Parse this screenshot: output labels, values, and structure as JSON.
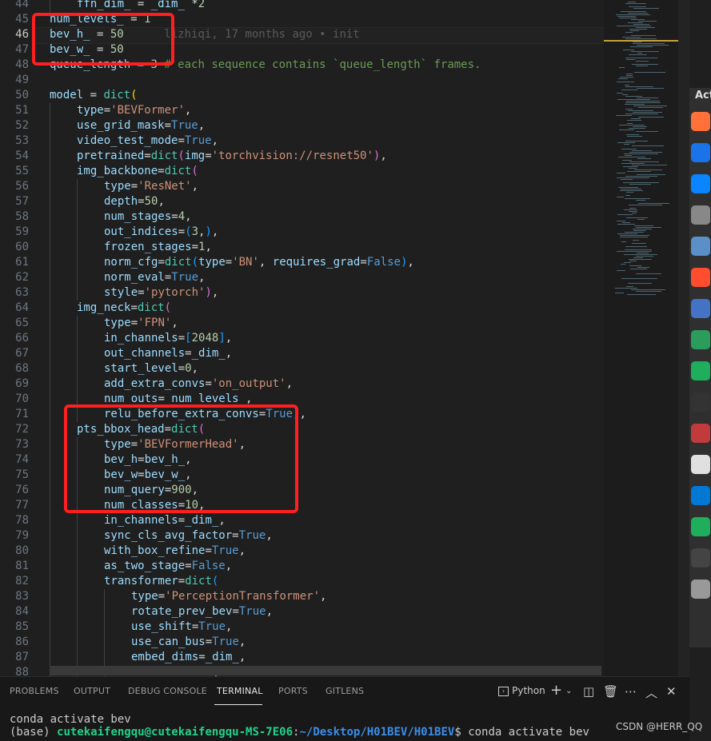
{
  "editor": {
    "active_line": 46,
    "blame_text": "lizhiqi, 17 months ago • init",
    "lines": [
      {
        "n": 44,
        "indent": 1,
        "parts": [
          [
            "k",
            "ffn_dim_"
          ],
          [
            "o",
            " = "
          ],
          [
            "k",
            "_dim_"
          ],
          [
            "o",
            " *"
          ],
          [
            "n",
            "2"
          ]
        ]
      },
      {
        "n": 45,
        "indent": 0,
        "parts": [
          [
            "k",
            "num_levels_"
          ],
          [
            "o",
            " = "
          ],
          [
            "n",
            "1"
          ]
        ]
      },
      {
        "n": 46,
        "indent": 0,
        "parts": [
          [
            "k",
            "bev_h_"
          ],
          [
            "o",
            " = "
          ],
          [
            "n",
            "50"
          ]
        ]
      },
      {
        "n": 47,
        "indent": 0,
        "parts": [
          [
            "k",
            "bev_w_"
          ],
          [
            "o",
            " = "
          ],
          [
            "n",
            "50"
          ]
        ]
      },
      {
        "n": 48,
        "indent": 0,
        "parts": [
          [
            "k",
            "queue_length"
          ],
          [
            "o",
            " = "
          ],
          [
            "n",
            "3"
          ],
          [
            "c",
            " # each sequence contains `queue_length` frames."
          ]
        ]
      },
      {
        "n": 49,
        "indent": 0,
        "parts": []
      },
      {
        "n": 50,
        "indent": 0,
        "parts": [
          [
            "k",
            "model"
          ],
          [
            "o",
            " = "
          ],
          [
            "f",
            "dict"
          ],
          [
            "p",
            "("
          ]
        ]
      },
      {
        "n": 51,
        "indent": 1,
        "parts": [
          [
            "k",
            "type"
          ],
          [
            "o",
            "="
          ],
          [
            "s",
            "'BEVFormer'"
          ],
          [
            "o",
            ","
          ]
        ]
      },
      {
        "n": 52,
        "indent": 1,
        "parts": [
          [
            "k",
            "use_grid_mask"
          ],
          [
            "o",
            "="
          ],
          [
            "kw",
            "True"
          ],
          [
            "o",
            ","
          ]
        ]
      },
      {
        "n": 53,
        "indent": 1,
        "parts": [
          [
            "k",
            "video_test_mode"
          ],
          [
            "o",
            "="
          ],
          [
            "kw",
            "True"
          ],
          [
            "o",
            ","
          ]
        ]
      },
      {
        "n": 54,
        "indent": 1,
        "parts": [
          [
            "k",
            "pretrained"
          ],
          [
            "o",
            "="
          ],
          [
            "f",
            "dict"
          ],
          [
            "p2",
            "("
          ],
          [
            "k",
            "img"
          ],
          [
            "o",
            "="
          ],
          [
            "s",
            "'torchvision://resnet50'"
          ],
          [
            "p2",
            ")"
          ],
          [
            "o",
            ","
          ]
        ]
      },
      {
        "n": 55,
        "indent": 1,
        "parts": [
          [
            "k",
            "img_backbone"
          ],
          [
            "o",
            "="
          ],
          [
            "f",
            "dict"
          ],
          [
            "p2",
            "("
          ]
        ]
      },
      {
        "n": 56,
        "indent": 2,
        "parts": [
          [
            "k",
            "type"
          ],
          [
            "o",
            "="
          ],
          [
            "s",
            "'ResNet'"
          ],
          [
            "o",
            ","
          ]
        ]
      },
      {
        "n": 57,
        "indent": 2,
        "parts": [
          [
            "k",
            "depth"
          ],
          [
            "o",
            "="
          ],
          [
            "n",
            "50"
          ],
          [
            "o",
            ","
          ]
        ]
      },
      {
        "n": 58,
        "indent": 2,
        "parts": [
          [
            "k",
            "num_stages"
          ],
          [
            "o",
            "="
          ],
          [
            "n",
            "4"
          ],
          [
            "o",
            ","
          ]
        ]
      },
      {
        "n": 59,
        "indent": 2,
        "parts": [
          [
            "k",
            "out_indices"
          ],
          [
            "o",
            "="
          ],
          [
            "p3",
            "("
          ],
          [
            "n",
            "3"
          ],
          [
            "o",
            ","
          ],
          [
            "p3",
            ")"
          ],
          [
            "o",
            ","
          ]
        ]
      },
      {
        "n": 60,
        "indent": 2,
        "parts": [
          [
            "k",
            "frozen_stages"
          ],
          [
            "o",
            "="
          ],
          [
            "n",
            "1"
          ],
          [
            "o",
            ","
          ]
        ]
      },
      {
        "n": 61,
        "indent": 2,
        "parts": [
          [
            "k",
            "norm_cfg"
          ],
          [
            "o",
            "="
          ],
          [
            "f",
            "dict"
          ],
          [
            "p3",
            "("
          ],
          [
            "k",
            "type"
          ],
          [
            "o",
            "="
          ],
          [
            "s",
            "'BN'"
          ],
          [
            "o",
            ", "
          ],
          [
            "k",
            "requires_grad"
          ],
          [
            "o",
            "="
          ],
          [
            "kw",
            "False"
          ],
          [
            "p3",
            ")"
          ],
          [
            "o",
            ","
          ]
        ]
      },
      {
        "n": 62,
        "indent": 2,
        "parts": [
          [
            "k",
            "norm_eval"
          ],
          [
            "o",
            "="
          ],
          [
            "kw",
            "True"
          ],
          [
            "o",
            ","
          ]
        ]
      },
      {
        "n": 63,
        "indent": 2,
        "parts": [
          [
            "k",
            "style"
          ],
          [
            "o",
            "="
          ],
          [
            "s",
            "'pytorch'"
          ],
          [
            "p2",
            ")"
          ],
          [
            "o",
            ","
          ]
        ]
      },
      {
        "n": 64,
        "indent": 1,
        "parts": [
          [
            "k",
            "img_neck"
          ],
          [
            "o",
            "="
          ],
          [
            "f",
            "dict"
          ],
          [
            "p2",
            "("
          ]
        ]
      },
      {
        "n": 65,
        "indent": 2,
        "parts": [
          [
            "k",
            "type"
          ],
          [
            "o",
            "="
          ],
          [
            "s",
            "'FPN'"
          ],
          [
            "o",
            ","
          ]
        ]
      },
      {
        "n": 66,
        "indent": 2,
        "parts": [
          [
            "k",
            "in_channels"
          ],
          [
            "o",
            "="
          ],
          [
            "p3",
            "["
          ],
          [
            "n",
            "2048"
          ],
          [
            "p3",
            "]"
          ],
          [
            "o",
            ","
          ]
        ]
      },
      {
        "n": 67,
        "indent": 2,
        "parts": [
          [
            "k",
            "out_channels"
          ],
          [
            "o",
            "="
          ],
          [
            "k",
            "_dim_"
          ],
          [
            "o",
            ","
          ]
        ]
      },
      {
        "n": 68,
        "indent": 2,
        "parts": [
          [
            "k",
            "start_level"
          ],
          [
            "o",
            "="
          ],
          [
            "n",
            "0"
          ],
          [
            "o",
            ","
          ]
        ]
      },
      {
        "n": 69,
        "indent": 2,
        "parts": [
          [
            "k",
            "add_extra_convs"
          ],
          [
            "o",
            "="
          ],
          [
            "s",
            "'on_output'"
          ],
          [
            "o",
            ","
          ]
        ]
      },
      {
        "n": 70,
        "indent": 2,
        "parts": [
          [
            "k",
            "num_outs"
          ],
          [
            "o",
            "="
          ],
          [
            "k",
            "_num_levels_"
          ],
          [
            "o",
            ","
          ]
        ]
      },
      {
        "n": 71,
        "indent": 2,
        "parts": [
          [
            "k",
            "relu_before_extra_convs"
          ],
          [
            "o",
            "="
          ],
          [
            "kw",
            "True"
          ],
          [
            "p2",
            ")"
          ],
          [
            "o",
            ","
          ]
        ]
      },
      {
        "n": 72,
        "indent": 1,
        "parts": [
          [
            "k",
            "pts_bbox_head"
          ],
          [
            "o",
            "="
          ],
          [
            "f",
            "dict"
          ],
          [
            "p2",
            "("
          ]
        ]
      },
      {
        "n": 73,
        "indent": 2,
        "parts": [
          [
            "k",
            "type"
          ],
          [
            "o",
            "="
          ],
          [
            "s",
            "'BEVFormerHead'"
          ],
          [
            "o",
            ","
          ]
        ]
      },
      {
        "n": 74,
        "indent": 2,
        "parts": [
          [
            "k",
            "bev_h"
          ],
          [
            "o",
            "="
          ],
          [
            "k",
            "bev_h_"
          ],
          [
            "o",
            ","
          ]
        ]
      },
      {
        "n": 75,
        "indent": 2,
        "parts": [
          [
            "k",
            "bev_w"
          ],
          [
            "o",
            "="
          ],
          [
            "k",
            "bev_w_"
          ],
          [
            "o",
            ","
          ]
        ]
      },
      {
        "n": 76,
        "indent": 2,
        "parts": [
          [
            "k",
            "num_query"
          ],
          [
            "o",
            "="
          ],
          [
            "n",
            "900"
          ],
          [
            "o",
            ","
          ]
        ]
      },
      {
        "n": 77,
        "indent": 2,
        "parts": [
          [
            "k",
            "num_classes"
          ],
          [
            "o",
            "="
          ],
          [
            "n",
            "10"
          ],
          [
            "o",
            ","
          ]
        ]
      },
      {
        "n": 78,
        "indent": 2,
        "parts": [
          [
            "k",
            "in_channels"
          ],
          [
            "o",
            "="
          ],
          [
            "k",
            "_dim_"
          ],
          [
            "o",
            ","
          ]
        ]
      },
      {
        "n": 79,
        "indent": 2,
        "parts": [
          [
            "k",
            "sync_cls_avg_factor"
          ],
          [
            "o",
            "="
          ],
          [
            "kw",
            "True"
          ],
          [
            "o",
            ","
          ]
        ]
      },
      {
        "n": 80,
        "indent": 2,
        "parts": [
          [
            "k",
            "with_box_refine"
          ],
          [
            "o",
            "="
          ],
          [
            "kw",
            "True"
          ],
          [
            "o",
            ","
          ]
        ]
      },
      {
        "n": 81,
        "indent": 2,
        "parts": [
          [
            "k",
            "as_two_stage"
          ],
          [
            "o",
            "="
          ],
          [
            "kw",
            "False"
          ],
          [
            "o",
            ","
          ]
        ]
      },
      {
        "n": 82,
        "indent": 2,
        "parts": [
          [
            "k",
            "transformer"
          ],
          [
            "o",
            "="
          ],
          [
            "f",
            "dict"
          ],
          [
            "p3",
            "("
          ]
        ]
      },
      {
        "n": 83,
        "indent": 3,
        "parts": [
          [
            "k",
            "type"
          ],
          [
            "o",
            "="
          ],
          [
            "s",
            "'PerceptionTransformer'"
          ],
          [
            "o",
            ","
          ]
        ]
      },
      {
        "n": 84,
        "indent": 3,
        "parts": [
          [
            "k",
            "rotate_prev_bev"
          ],
          [
            "o",
            "="
          ],
          [
            "kw",
            "True"
          ],
          [
            "o",
            ","
          ]
        ]
      },
      {
        "n": 85,
        "indent": 3,
        "parts": [
          [
            "k",
            "use_shift"
          ],
          [
            "o",
            "="
          ],
          [
            "kw",
            "True"
          ],
          [
            "o",
            ","
          ]
        ]
      },
      {
        "n": 86,
        "indent": 3,
        "parts": [
          [
            "k",
            "use_can_bus"
          ],
          [
            "o",
            "="
          ],
          [
            "kw",
            "True"
          ],
          [
            "o",
            ","
          ]
        ]
      },
      {
        "n": 87,
        "indent": 3,
        "parts": [
          [
            "k",
            "embed_dims"
          ],
          [
            "o",
            "="
          ],
          [
            "k",
            "_dim_"
          ],
          [
            "o",
            ","
          ]
        ]
      },
      {
        "n": 88,
        "indent": 3,
        "parts": [
          [
            "k",
            "encoder"
          ],
          [
            "o",
            "="
          ],
          [
            "f",
            "dict"
          ],
          [
            "p",
            "("
          ]
        ]
      }
    ]
  },
  "dock": {
    "label": "Act",
    "apps": [
      "firefox",
      "chrome",
      "thunderbird",
      "files",
      "app",
      "app",
      "document",
      "clion",
      "pycharm",
      "terminal",
      "app",
      "app",
      "vscode",
      "pycharm",
      "obs",
      "apps-grid"
    ]
  },
  "panel": {
    "tabs": [
      "PROBLEMS",
      "OUTPUT",
      "DEBUG CONSOLE",
      "TERMINAL",
      "PORTS",
      "GITLENS"
    ],
    "active_tab": "TERMINAL",
    "shell_label": "Python"
  },
  "terminal": {
    "line1": "conda activate bev",
    "prefix": "(base) ",
    "user_host": "cutekaifengqu@cutekaifengqu-MS-7E06",
    "colon": ":",
    "path": "~/Desktop/H01BEV/H01BEV",
    "dollar": "$ ",
    "command": "conda activate bev"
  },
  "watermark": "CSDN @HERR_QQ",
  "colors": {
    "annotation": "#ff1f1f",
    "background": "#1f1f1f"
  }
}
